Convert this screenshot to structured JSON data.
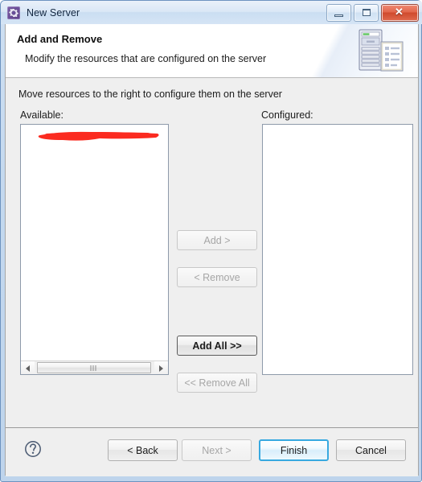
{
  "window": {
    "title": "New Server",
    "icon": "server-gear-icon",
    "controls": {
      "minimize": "minimize-button",
      "maximize": "maximize-button",
      "close": "close-button",
      "close_glyph": "✕"
    },
    "frame_color": "#6d93c0",
    "titlebar_color": "#d5e4f5"
  },
  "header": {
    "title": "Add and Remove",
    "subtitle": "Modify the resources that are configured on the server",
    "icon": "server-document-icon"
  },
  "main": {
    "instruction": "Move resources to the right to configure them on the server",
    "available": {
      "label": "Available:",
      "items": [],
      "redacted_item": "",
      "redaction_color": "#fb2b20",
      "scrollbar": {
        "left_arrow": "◀",
        "right_arrow": "▶",
        "thumb_grip": "|||"
      }
    },
    "configured": {
      "label": "Configured:",
      "items": []
    },
    "transfer_buttons": [
      {
        "label": "Add >",
        "state": "disabled",
        "name": "add-button"
      },
      {
        "label": "< Remove",
        "state": "disabled",
        "name": "remove-button"
      },
      {
        "label": "Add All >>",
        "state": "default",
        "name": "add-all-button"
      },
      {
        "label": "<< Remove All",
        "state": "disabled",
        "name": "remove-all-button"
      }
    ]
  },
  "footer": {
    "help_icon": "help-question-icon",
    "buttons": [
      {
        "label": "< Back",
        "state": "enabled",
        "name": "back-button"
      },
      {
        "label": "Next >",
        "state": "disabled",
        "name": "next-button"
      },
      {
        "label": "Finish",
        "state": "focused",
        "name": "finish-button"
      },
      {
        "label": "Cancel",
        "state": "enabled",
        "name": "cancel-button"
      }
    ],
    "focus_color": "#37a9e0"
  }
}
